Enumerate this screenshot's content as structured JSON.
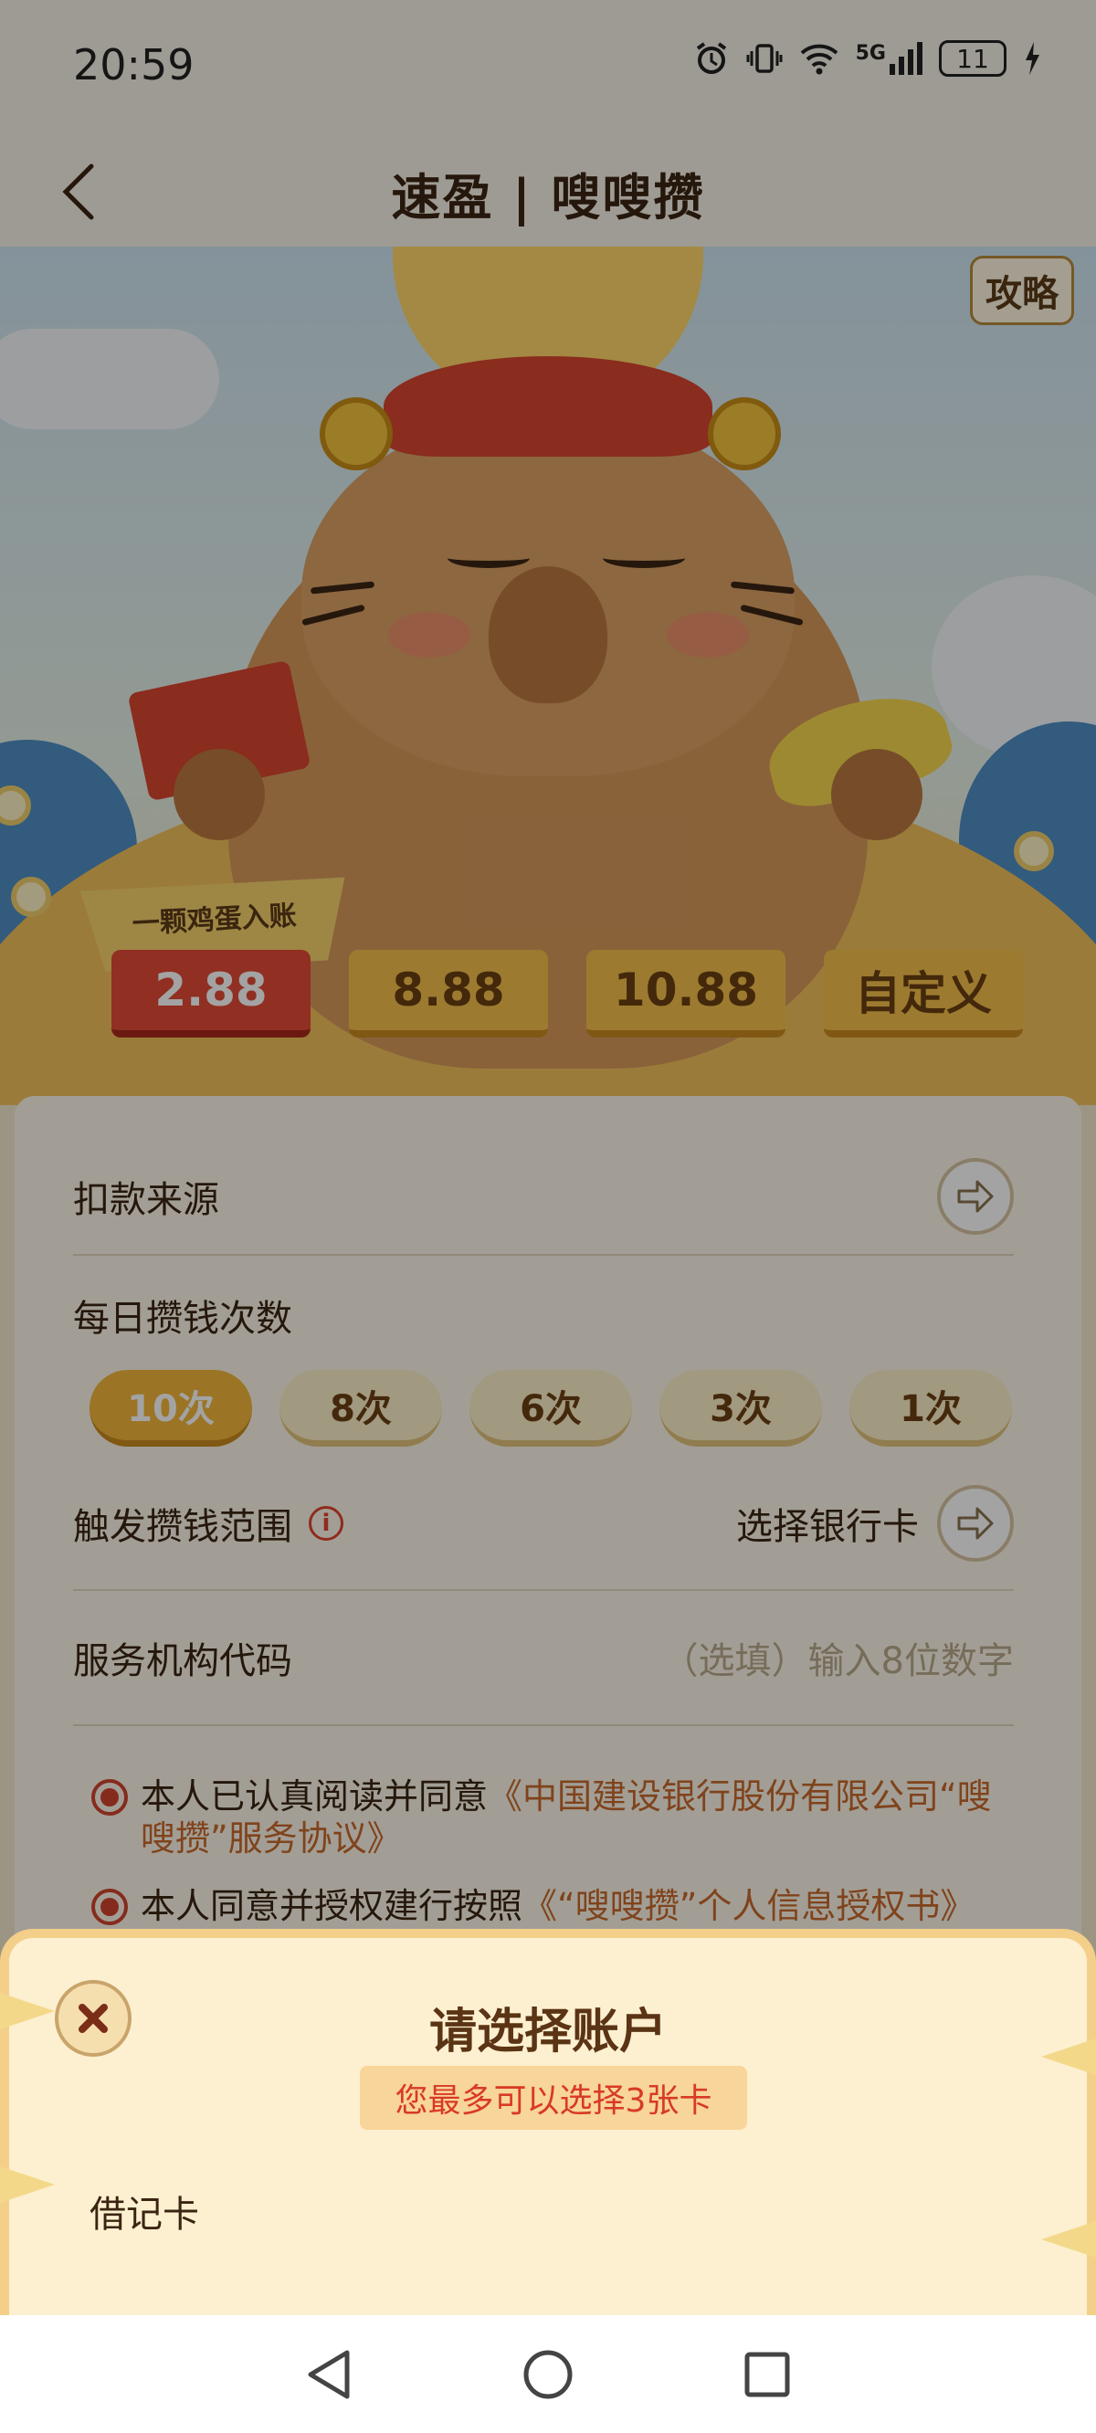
{
  "status_bar": {
    "time": "20:59",
    "icons": [
      "alarm-icon",
      "vibrate-icon",
      "wifi-icon",
      "signal-5g-icon",
      "battery-icon",
      "charging-icon"
    ],
    "battery_level": "11",
    "network": "5G"
  },
  "header": {
    "title": "速盈 | 嗖嗖攒",
    "back_icon": "chevron-left-icon"
  },
  "hero": {
    "guide_label": "攻略",
    "ribbon_text": "一颗鸡蛋入账"
  },
  "amounts": [
    {
      "label": "2.88",
      "selected": true
    },
    {
      "label": "8.88",
      "selected": false
    },
    {
      "label": "10.88",
      "selected": false
    },
    {
      "label": "自定义",
      "selected": false
    }
  ],
  "form": {
    "debit_source_label": "扣款来源",
    "daily_count_label": "每日攒钱次数",
    "counts": [
      {
        "label": "10次",
        "selected": true
      },
      {
        "label": "8次",
        "selected": false
      },
      {
        "label": "6次",
        "selected": false
      },
      {
        "label": "3次",
        "selected": false
      },
      {
        "label": "1次",
        "selected": false
      }
    ],
    "trigger_range_label": "触发攒钱范围",
    "select_card_label": "选择银行卡",
    "org_code_label": "服务机构代码",
    "org_code_placeholder": "（选填）输入8位数字",
    "agreement1_prefix": "本人已认真阅读并同意",
    "agreement1_link": "《中国建设银行股份有限公司“嗖嗖攒”服务协议》",
    "agreement2_prefix": "本人同意并授权建行按照",
    "agreement2_link": "《“嗖嗖攒”个人信息授权书》"
  },
  "sheet": {
    "title": "请选择账户",
    "hint": "您最多可以选择3张卡",
    "section_label": "借记卡"
  },
  "colors": {
    "accent_red": "#e24a36",
    "accent_gold": "#f3b63a",
    "text_brown": "#3b2412",
    "sheet_bg": "#fdf0d0"
  }
}
